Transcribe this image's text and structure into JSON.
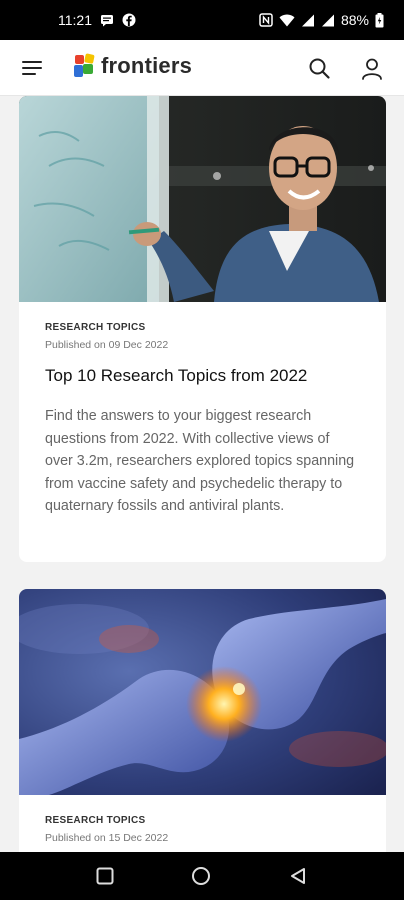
{
  "status_bar": {
    "time": "11:21",
    "battery": "88%",
    "icons": [
      "message-icon",
      "facebook-icon",
      "nfc-icon",
      "wifi-icon",
      "signal-icon",
      "signal-icon",
      "battery-icon"
    ]
  },
  "app_bar": {
    "logo_text": "frontiers",
    "icons": [
      "menu-icon",
      "search-icon",
      "user-icon"
    ]
  },
  "articles": [
    {
      "tag": "RESEARCH TOPICS",
      "date": "Published on 09 Dec 2022",
      "title": "Top 10 Research Topics from 2022",
      "description": "Find the answers to your biggest research questions from 2022. With collective views of over 3.2m, researchers explored topics spanning from vaccine safety and psychedelic therapy to quaternary fossils and antiviral plants."
    },
    {
      "tag": "RESEARCH TOPICS",
      "date": "Published on 15 Dec 2022"
    }
  ],
  "nav_bar": {
    "icons": [
      "recents-icon",
      "home-icon",
      "back-icon"
    ]
  },
  "colors": {
    "background": "#f2f2f2",
    "card": "#ffffff",
    "status_bar": "#000000",
    "logo_red": "#e8412c",
    "logo_yellow": "#f5c400",
    "logo_green": "#3aaa35",
    "logo_blue": "#2f6fd6"
  }
}
